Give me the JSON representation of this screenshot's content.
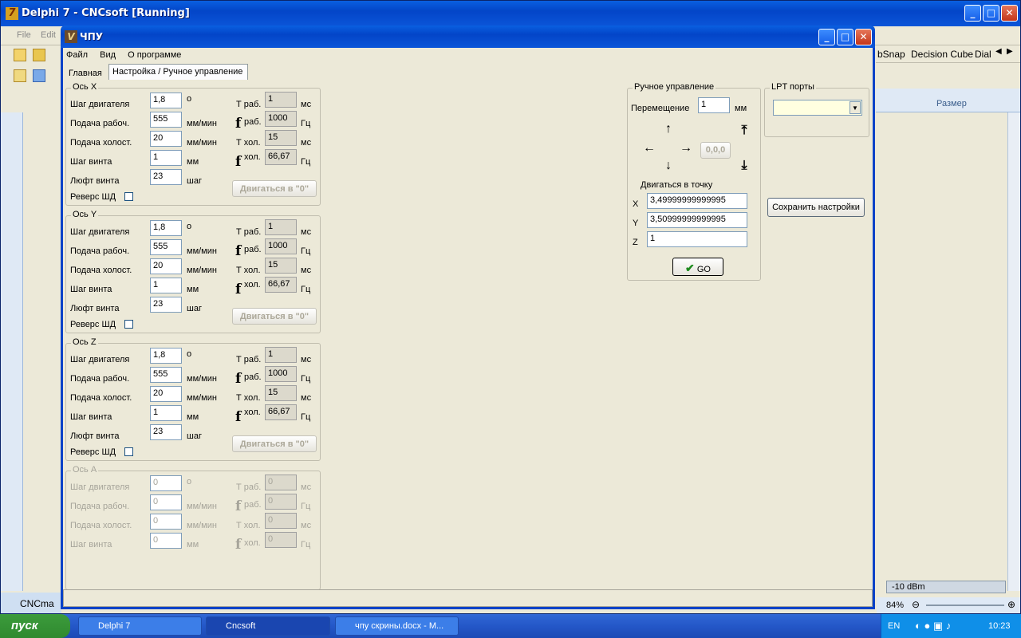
{
  "outer": {
    "title": "Delphi 7 - CNCsoft [Running]",
    "menu": [
      "File",
      "Edit"
    ],
    "right_tabs": [
      "bSnap",
      "Decision Cube",
      "Dial"
    ],
    "size_label": "Размер",
    "zoom": "84%",
    "dbm": "-10 dBm",
    "doc_tab": "CNCma"
  },
  "window": {
    "title": "ЧПУ",
    "menu": [
      "Файл",
      "Вид",
      "О программе"
    ],
    "tabs": [
      "Главная",
      "Настройка / Ручное управление"
    ]
  },
  "labels": {
    "step_motor": "Шаг двигателя",
    "feed_work": "Подача рабоч.",
    "feed_idle": "Подача холост.",
    "screw_step": "Шаг винта",
    "backlash": "Люфт винта",
    "reverse": "Реверс ШД",
    "deg": "о",
    "mm_min": "мм/мин",
    "mm": "мм",
    "step": "шаг",
    "t_work": "Т раб.",
    "f": "f",
    "f_work": "раб.",
    "t_idle": "Т хол.",
    "f_idle": "хол.",
    "ms": "мс",
    "hz": "Гц",
    "go_zero": "Двигаться в \"0\""
  },
  "axes": [
    {
      "title": "Ось X",
      "step": "1,8",
      "feed_work": "555",
      "feed_idle": "20",
      "screw": "1",
      "backlash": "23",
      "t_work": "1",
      "f_work": "1000",
      "t_idle": "15",
      "f_idle": "66,67"
    },
    {
      "title": "Ось Y",
      "step": "1,8",
      "feed_work": "555",
      "feed_idle": "20",
      "screw": "1",
      "backlash": "23",
      "t_work": "1",
      "f_work": "1000",
      "t_idle": "15",
      "f_idle": "66,67"
    },
    {
      "title": "Ось Z",
      "step": "1,8",
      "feed_work": "555",
      "feed_idle": "20",
      "screw": "1",
      "backlash": "23",
      "t_work": "1",
      "f_work": "1000",
      "t_idle": "15",
      "f_idle": "66,67"
    },
    {
      "title": "Ось A",
      "step": "0",
      "feed_work": "0",
      "feed_idle": "0",
      "screw": "0",
      "t_work": "0",
      "f_work": "0",
      "t_idle": "0",
      "f_idle": "0"
    }
  ],
  "manual": {
    "title": "Ручное управление",
    "move_label": "Перемещение",
    "move_value": "1",
    "mm": "мм",
    "origin": "0,0,0",
    "goto_label": "Двигаться в точку",
    "x_label": "X",
    "x": "3,49999999999995",
    "y_label": "Y",
    "y": "3,50999999999995",
    "z_label": "Z",
    "z": "1",
    "go": "GO",
    "arrow_up": "🡑",
    "arrow_down": "🡓",
    "arrow_left": "🡐",
    "arrow_right": "🡒",
    "z_up": "⤒",
    "z_down": "⤓"
  },
  "lpt": {
    "title": "LPT порты",
    "value": ""
  },
  "save_button": "Сохранить настройки",
  "taskbar": {
    "start": "пуск",
    "items": [
      "Delphi 7",
      "Cncsoft",
      "чпу скрины.docx - M..."
    ],
    "lang": "EN",
    "clock": "10:23"
  }
}
